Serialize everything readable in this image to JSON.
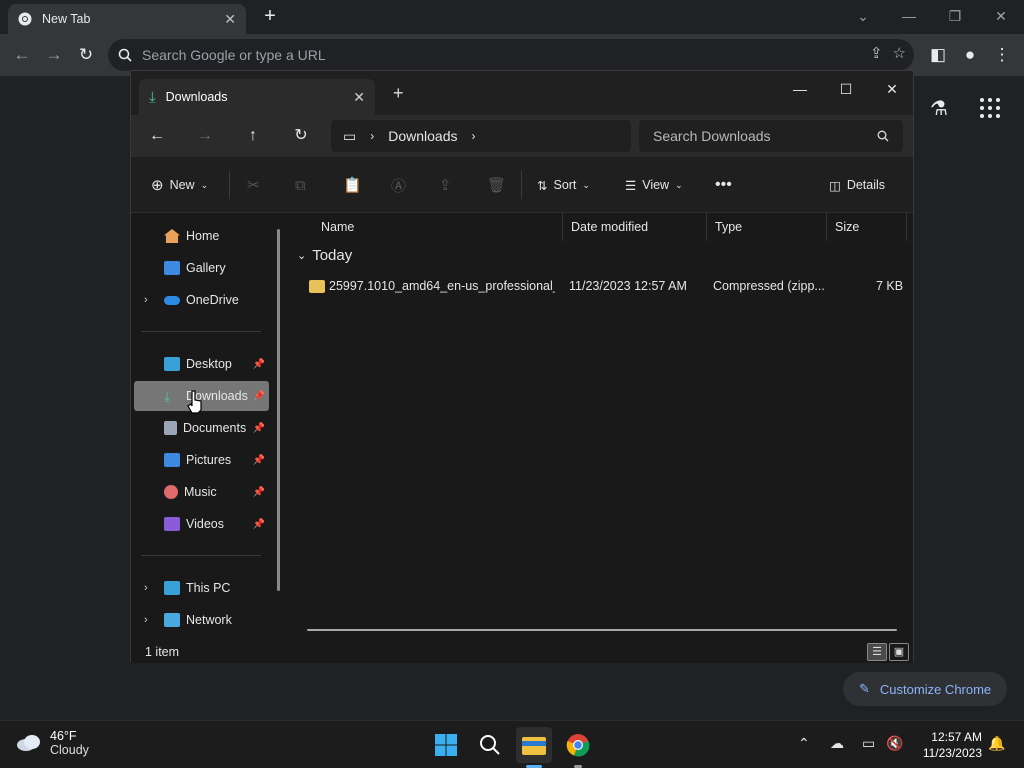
{
  "chrome": {
    "tab_title": "New Tab",
    "omnibox_placeholder": "Search Google or type a URL",
    "customize_label": "Customize Chrome"
  },
  "explorer": {
    "tab_title": "Downloads",
    "breadcrumb": [
      "Downloads"
    ],
    "search_placeholder": "Search Downloads",
    "cmd": {
      "new_label": "New",
      "sort_label": "Sort",
      "view_label": "View",
      "details_label": "Details"
    },
    "nav": {
      "home": "Home",
      "gallery": "Gallery",
      "onedrive": "OneDrive",
      "desktop": "Desktop",
      "downloads": "Downloads",
      "documents": "Documents",
      "pictures": "Pictures",
      "music": "Music",
      "videos": "Videos",
      "thispc": "This PC",
      "network": "Network"
    },
    "columns": {
      "name": "Name",
      "date": "Date modified",
      "type": "Type",
      "size": "Size"
    },
    "group_label": "Today",
    "files": [
      {
        "name": "25997.1010_amd64_en-us_professional_e...",
        "date": "11/23/2023 12:57 AM",
        "type": "Compressed (zipp...",
        "size": "7 KB"
      }
    ],
    "status": "1 item"
  },
  "taskbar": {
    "temp": "46°F",
    "condition": "Cloudy",
    "time": "12:57 AM",
    "date": "11/23/2023"
  }
}
